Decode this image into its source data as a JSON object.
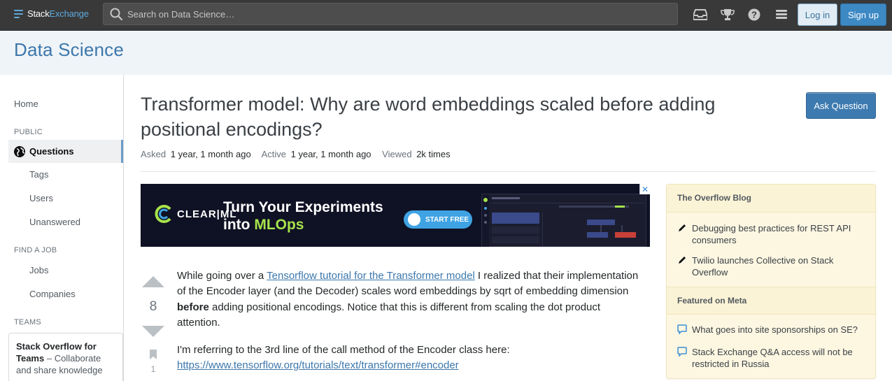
{
  "topbar": {
    "logo_stack": "Stack",
    "logo_exchange": "Exchange",
    "search_placeholder": "Search on Data Science…",
    "login_label": "Log in",
    "signup_label": "Sign up",
    "icons": [
      "inbox-icon",
      "trophy-icon",
      "help-icon",
      "site-switcher-icon"
    ]
  },
  "site": {
    "title": "Data Science"
  },
  "leftnav": {
    "home": "Home",
    "public_label": "PUBLIC",
    "questions": "Questions",
    "tags": "Tags",
    "users": "Users",
    "unanswered": "Unanswered",
    "find_job_label": "FIND A JOB",
    "jobs": "Jobs",
    "companies": "Companies",
    "teams_label": "TEAMS",
    "teams_title": "Stack Overflow for Teams",
    "teams_text": " – Collaborate and share knowledge"
  },
  "question": {
    "title": "Transformer model: Why are word embeddings scaled before adding positional encodings?",
    "ask_button": "Ask Question",
    "asked_label": "Asked",
    "asked_value": "1 year, 1 month ago",
    "active_label": "Active",
    "active_value": "1 year, 1 month ago",
    "viewed_label": "Viewed",
    "viewed_value": "2k times",
    "votes": "8",
    "bookmarks": "1",
    "body": {
      "p1_before_link": "While going over a ",
      "p1_link": "Tensorflow tutorial for the Transformer model",
      "p1_after_link": " I realized that their implementation of the Encoder layer (and the Decoder) scales word embeddings by sqrt of embedding dimension ",
      "p1_bold": "before",
      "p1_end": " adding positional encodings. Notice that this is different from scaling the dot product attention.",
      "p2_text": "I'm referring to the 3rd line of the call method of the Encoder class here:",
      "p2_link": "https://www.tensorflow.org/tutorials/text/transformer#encoder"
    }
  },
  "ad": {
    "brand": "CLEAR|ML",
    "headline_line1": "Turn Your Experiments",
    "headline_into": "into ",
    "headline_accent": "MLOps",
    "cta": "START FREE",
    "close": "✕"
  },
  "sidebar": {
    "blog_title": "The Overflow Blog",
    "blog_items": [
      "Debugging best practices for REST API consumers",
      "Twilio launches Collective on Stack Overflow"
    ],
    "meta_title": "Featured on Meta",
    "meta_items": [
      "What goes into site sponsorships on SE?",
      "Stack Exchange Q&A access will not be restricted in Russia"
    ]
  },
  "colors": {
    "topbar": "#393939",
    "brand_blue": "#3c77ab",
    "button_blue": "#3d7ab0",
    "widget_bg": "#fdf7e2"
  }
}
